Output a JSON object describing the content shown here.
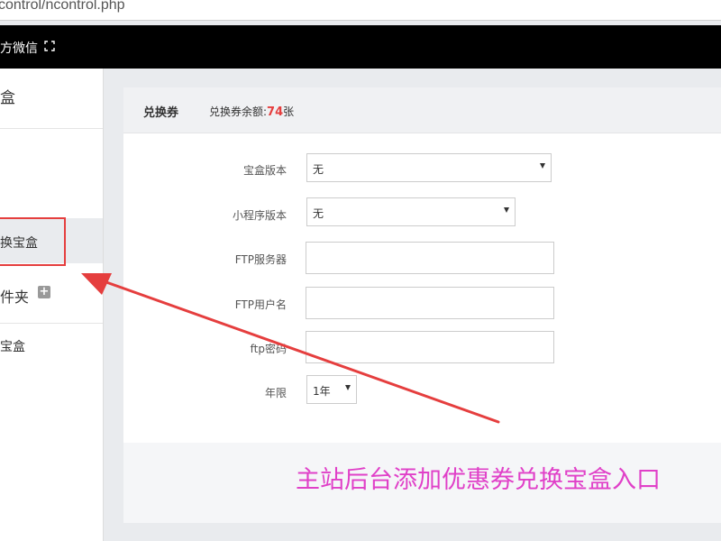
{
  "browser": {
    "url": "control/ncontrol.php"
  },
  "header": {
    "brand": "方微信"
  },
  "sidebar": {
    "title": "盒",
    "items": [
      {
        "label": ""
      },
      {
        "label": ""
      },
      {
        "label": "换宝盒"
      },
      {
        "label": "件夹"
      },
      {
        "label": "宝盒"
      }
    ]
  },
  "panel": {
    "title": "兑换券",
    "balance_label": "兑换券余额:",
    "balance_value": "74",
    "balance_unit": "张"
  },
  "form": {
    "box_version": {
      "label": "宝盒版本",
      "value": "无"
    },
    "miniprogram_version": {
      "label": "小程序版本",
      "value": "无"
    },
    "ftp_server": {
      "label": "FTP服务器",
      "value": ""
    },
    "ftp_user": {
      "label": "FTP用户名",
      "value": ""
    },
    "ftp_password": {
      "label": "ftp密码",
      "value": ""
    },
    "term": {
      "label": "年限",
      "value": "1年"
    }
  },
  "annotation": {
    "caption": "主站后台添加优惠券兑换宝盒入口",
    "color": "#e040c8",
    "arrow_color": "#e53e3e"
  }
}
